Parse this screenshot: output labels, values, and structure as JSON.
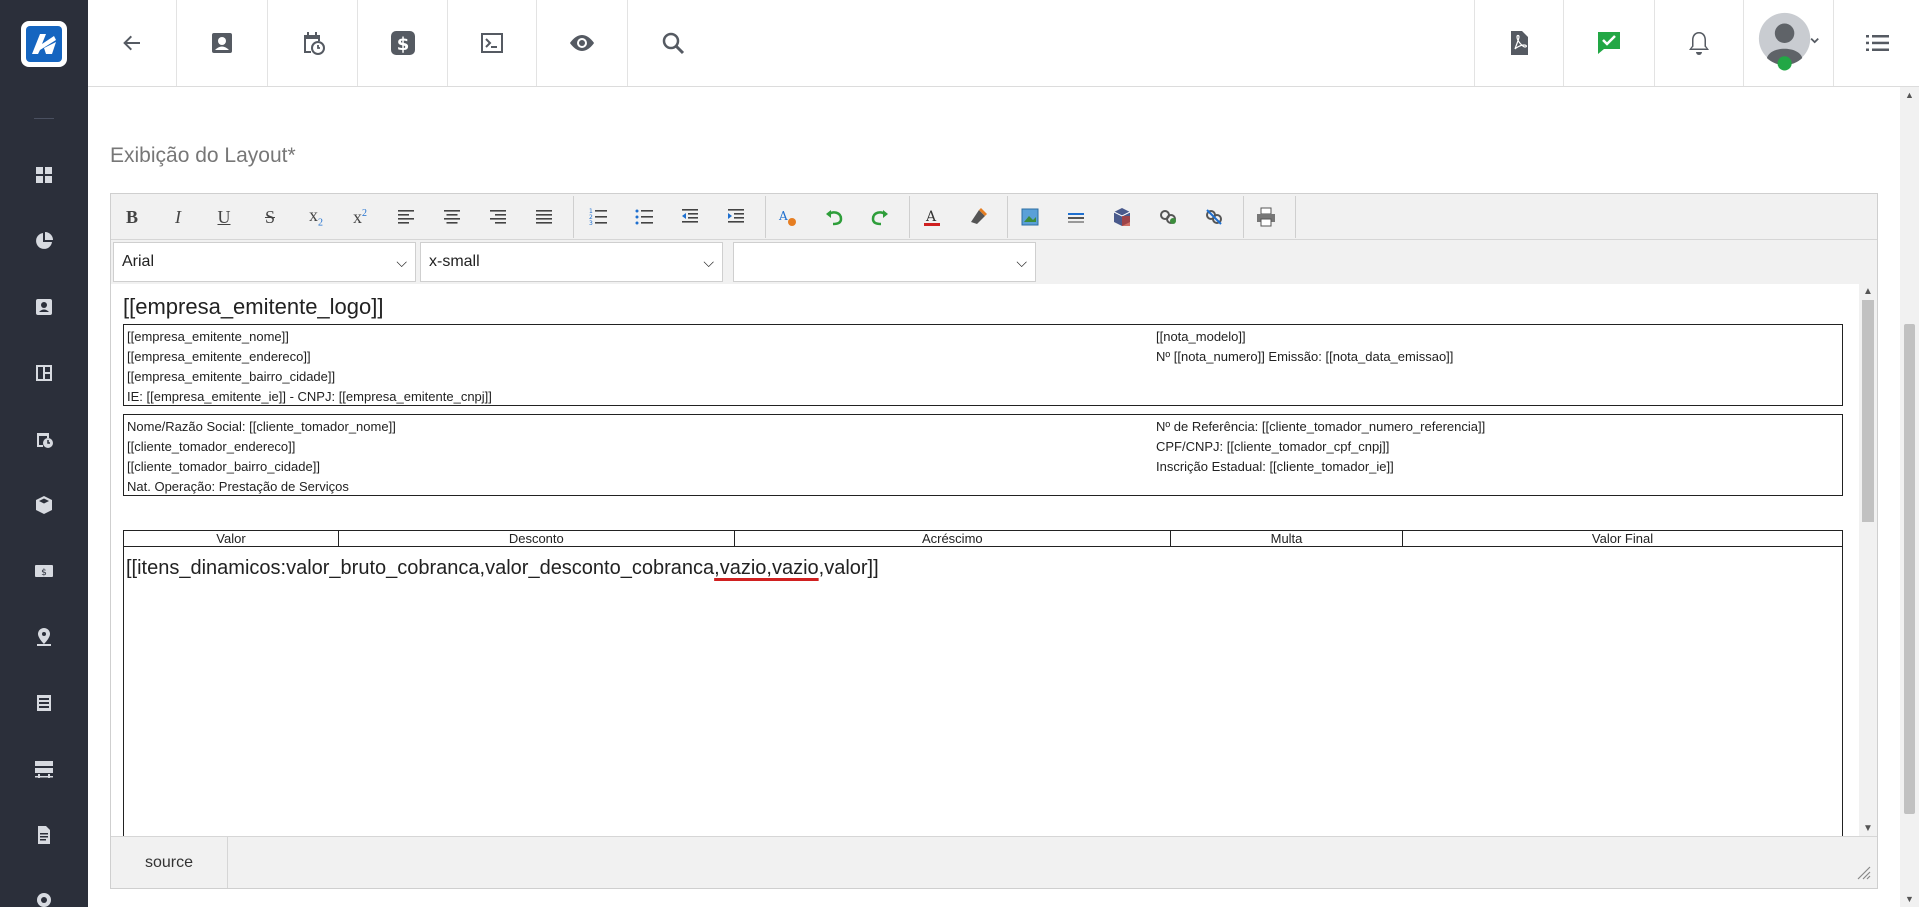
{
  "sidebar": {
    "logo_icon": "brand-logo-icon",
    "items": [
      {
        "icon": "dashboard-icon"
      },
      {
        "icon": "pie-chart-icon"
      },
      {
        "icon": "contact-card-icon"
      },
      {
        "icon": "layout-icon"
      },
      {
        "icon": "calendar-clock-icon"
      },
      {
        "icon": "package-icon"
      },
      {
        "icon": "money-icon"
      },
      {
        "icon": "map-pin-icon"
      },
      {
        "icon": "list-icon"
      },
      {
        "icon": "server-icon"
      },
      {
        "icon": "document-icon"
      },
      {
        "icon": "gear-icon"
      }
    ]
  },
  "topbar": {
    "left_icons": [
      "back-arrow-icon",
      "contact-icon",
      "calendar-icon",
      "dollar-icon",
      "terminal-icon",
      "eye-icon",
      "search-icon"
    ],
    "right_icons": [
      "pdf-icon",
      "chat-check-icon",
      "bell-icon",
      "user-avatar",
      "menu-icon"
    ],
    "accent_green": "#22a745"
  },
  "main": {
    "title": "Exibição do Layout*"
  },
  "editor": {
    "font_select": "Arial",
    "size_select": "x-small",
    "format_select": "",
    "status_tab": "source",
    "doc": {
      "logo_placeholder": "[[empresa_emitente_logo]]",
      "header_box": {
        "left": [
          "[[empresa_emitente_nome]]",
          "[[empresa_emitente_endereco]]",
          "[[empresa_emitente_bairro_cidade]]",
          "IE: [[empresa_emitente_ie]] - CNPJ: [[empresa_emitente_cnpj]]"
        ],
        "right": [
          "[[nota_modelo]]",
          "Nº [[nota_numero]] Emissão: [[nota_data_emissao]]"
        ]
      },
      "client_box": {
        "left": [
          "Nome/Razão Social: [[cliente_tomador_nome]]",
          "[[cliente_tomador_endereco]]",
          "[[cliente_tomador_bairro_cidade]]",
          "Nat. Operação: Prestação de Serviços"
        ],
        "right": [
          "Nº de Referência: [[cliente_tomador_numero_referencia]]",
          "CPF/CNPJ: [[cliente_tomador_cpf_cnpj]]",
          "Inscrição Estadual: [[cliente_tomador_ie]]"
        ]
      },
      "table_headers": [
        "Valor",
        "Desconto",
        "Acréscimo",
        "Multa",
        "Valor Final"
      ],
      "items_a": "[[itens_dinamicos:valor_bruto_cobranca,valor_desconto_cobranca",
      "items_b": ",vazio,vazio",
      "items_c": ",valor]]"
    }
  }
}
